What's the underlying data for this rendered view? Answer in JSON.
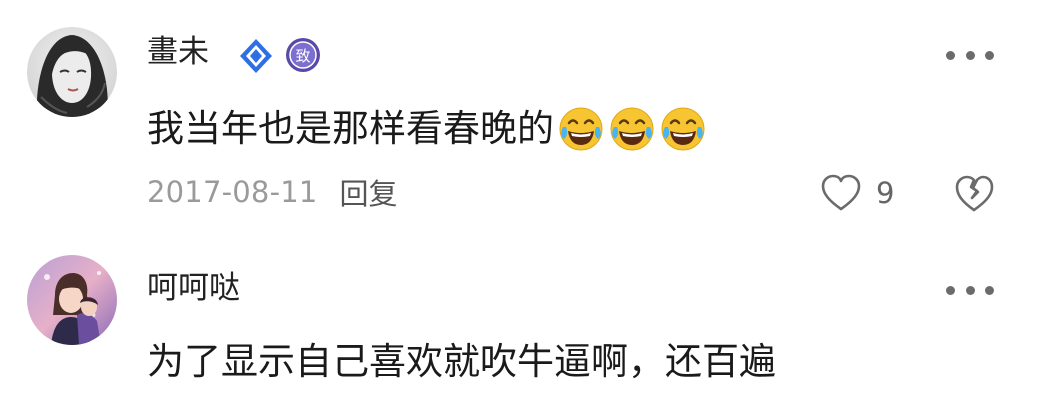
{
  "comments": [
    {
      "username": "畫未",
      "badge_level_text": "致",
      "text": "我当年也是那样看春晚的",
      "emoji_names": [
        "tears-of-joy-emoji",
        "tears-of-joy-emoji",
        "tears-of-joy-emoji"
      ],
      "timestamp": "2017-08-11",
      "reply_label": "回复",
      "like_count": "9"
    },
    {
      "username": "呵呵哒",
      "text": "为了显示自己喜欢就吹牛逼啊，还百遍"
    }
  ],
  "icons": {
    "more": "more-dots-icon",
    "like": "heart-icon",
    "dislike": "broken-heart-icon",
    "verified": "diamond-verified-icon"
  },
  "colors": {
    "badge_blue": "#2f6fe6",
    "badge_purple": "#5a4aa8",
    "emoji_yellow": "#f7c531",
    "emoji_tear": "#4ab3f2",
    "muted_text": "#9a9a9a",
    "icon_gray": "#6b6b6b"
  }
}
